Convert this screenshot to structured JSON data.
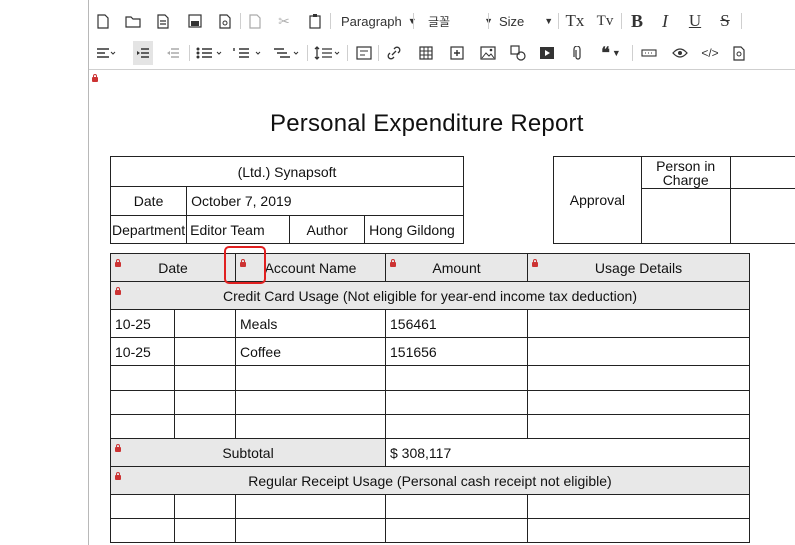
{
  "toolbar": {
    "paragraph_label": "Paragraph",
    "font_label": "글꼴",
    "size_label": "Size",
    "bold": "B",
    "italic": "I",
    "underline": "U",
    "strike": "S",
    "subscript": "Tx",
    "superscript": "Tv",
    "code": "</>"
  },
  "document": {
    "title": "Personal Expenditure Report",
    "company": "(Ltd.) Synapsoft",
    "date_label": "Date",
    "date_value": "October 7, 2019",
    "department_label": "Department",
    "department_value": "Editor Team",
    "author_label": "Author",
    "author_value": "Hong Gildong",
    "approval_label": "Approval",
    "person_in_charge_label": "Person in Charge"
  },
  "table": {
    "headers": [
      "Date",
      "Account Name",
      "Amount",
      "Usage Details"
    ],
    "section1_title": "Credit Card Usage (Not eligible for year-end income tax deduction)",
    "rows": [
      {
        "date": "10-25",
        "account": "Meals",
        "amount": "156461",
        "details": ""
      },
      {
        "date": "10-25",
        "account": "Coffee",
        "amount": "151656",
        "details": ""
      }
    ],
    "subtotal_label": "Subtotal",
    "subtotal_value": "$ 308,117",
    "section2_title": "Regular Receipt Usage (Personal cash receipt not eligible)"
  },
  "colors": {
    "highlight": "#e02020",
    "shaded_row": "#e8e8e8",
    "lock_icon": "#cc3333"
  }
}
